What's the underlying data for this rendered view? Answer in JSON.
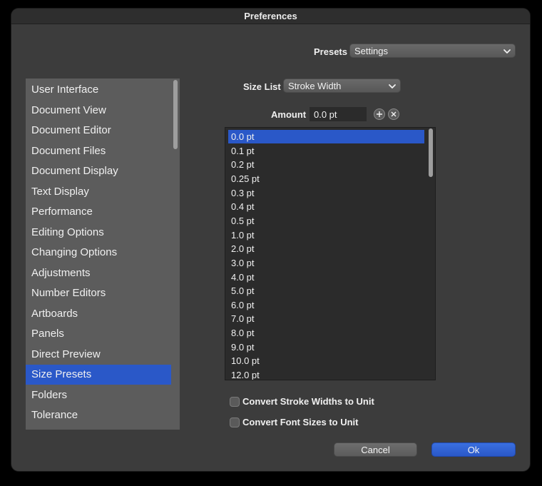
{
  "window": {
    "title": "Preferences"
  },
  "presets": {
    "label": "Presets",
    "value": "Settings"
  },
  "size_list": {
    "label": "Size List",
    "value": "Stroke Width"
  },
  "amount": {
    "label": "Amount",
    "value": "0.0 pt"
  },
  "sidebar": {
    "items": [
      {
        "label": "User Interface",
        "selected": false
      },
      {
        "label": "Document View",
        "selected": false
      },
      {
        "label": "Document Editor",
        "selected": false
      },
      {
        "label": "Document Files",
        "selected": false
      },
      {
        "label": "Document Display",
        "selected": false
      },
      {
        "label": "Text Display",
        "selected": false
      },
      {
        "label": "Performance",
        "selected": false
      },
      {
        "label": "Editing Options",
        "selected": false
      },
      {
        "label": "Changing Options",
        "selected": false
      },
      {
        "label": "Adjustments",
        "selected": false
      },
      {
        "label": "Number Editors",
        "selected": false
      },
      {
        "label": "Artboards",
        "selected": false
      },
      {
        "label": "Panels",
        "selected": false
      },
      {
        "label": "Direct Preview",
        "selected": false
      },
      {
        "label": "Size Presets",
        "selected": true
      },
      {
        "label": "Folders",
        "selected": false
      },
      {
        "label": "Tolerance",
        "selected": false
      }
    ]
  },
  "sizes": {
    "items": [
      "0.0 pt",
      "0.1 pt",
      "0.2 pt",
      "0.25 pt",
      "0.3 pt",
      "0.4 pt",
      "0.5 pt",
      "1.0 pt",
      "2.0 pt",
      "3.0 pt",
      "4.0 pt",
      "5.0 pt",
      "6.0 pt",
      "7.0 pt",
      "8.0 pt",
      "9.0 pt",
      "10.0 pt",
      "12.0 pt"
    ],
    "selected_index": 0
  },
  "options": {
    "convert_stroke_label": "Convert Stroke Widths to Unit",
    "convert_stroke_checked": false,
    "convert_font_label": "Convert Font Sizes to Unit",
    "convert_font_checked": false
  },
  "buttons": {
    "cancel": "Cancel",
    "ok": "Ok"
  },
  "colors": {
    "accent": "#2a58c8",
    "panel": "#3c3c3c"
  }
}
